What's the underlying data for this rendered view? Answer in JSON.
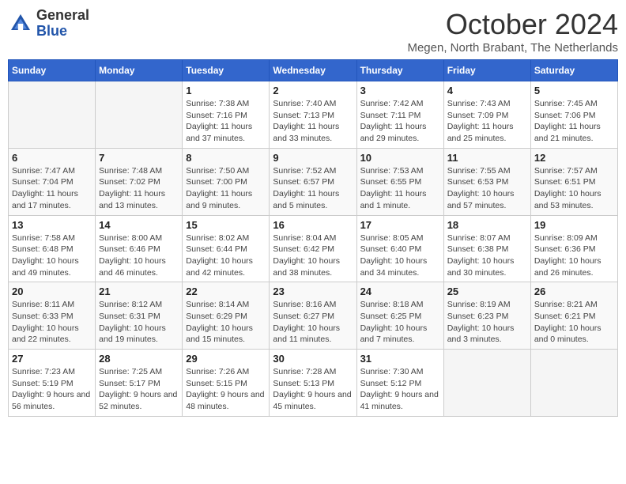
{
  "header": {
    "logo_line1": "General",
    "logo_line2": "Blue",
    "month_title": "October 2024",
    "subtitle": "Megen, North Brabant, The Netherlands"
  },
  "days_of_week": [
    "Sunday",
    "Monday",
    "Tuesday",
    "Wednesday",
    "Thursday",
    "Friday",
    "Saturday"
  ],
  "weeks": [
    [
      {
        "day": "",
        "detail": ""
      },
      {
        "day": "",
        "detail": ""
      },
      {
        "day": "1",
        "detail": "Sunrise: 7:38 AM\nSunset: 7:16 PM\nDaylight: 11 hours and 37 minutes."
      },
      {
        "day": "2",
        "detail": "Sunrise: 7:40 AM\nSunset: 7:13 PM\nDaylight: 11 hours and 33 minutes."
      },
      {
        "day": "3",
        "detail": "Sunrise: 7:42 AM\nSunset: 7:11 PM\nDaylight: 11 hours and 29 minutes."
      },
      {
        "day": "4",
        "detail": "Sunrise: 7:43 AM\nSunset: 7:09 PM\nDaylight: 11 hours and 25 minutes."
      },
      {
        "day": "5",
        "detail": "Sunrise: 7:45 AM\nSunset: 7:06 PM\nDaylight: 11 hours and 21 minutes."
      }
    ],
    [
      {
        "day": "6",
        "detail": "Sunrise: 7:47 AM\nSunset: 7:04 PM\nDaylight: 11 hours and 17 minutes."
      },
      {
        "day": "7",
        "detail": "Sunrise: 7:48 AM\nSunset: 7:02 PM\nDaylight: 11 hours and 13 minutes."
      },
      {
        "day": "8",
        "detail": "Sunrise: 7:50 AM\nSunset: 7:00 PM\nDaylight: 11 hours and 9 minutes."
      },
      {
        "day": "9",
        "detail": "Sunrise: 7:52 AM\nSunset: 6:57 PM\nDaylight: 11 hours and 5 minutes."
      },
      {
        "day": "10",
        "detail": "Sunrise: 7:53 AM\nSunset: 6:55 PM\nDaylight: 11 hours and 1 minute."
      },
      {
        "day": "11",
        "detail": "Sunrise: 7:55 AM\nSunset: 6:53 PM\nDaylight: 10 hours and 57 minutes."
      },
      {
        "day": "12",
        "detail": "Sunrise: 7:57 AM\nSunset: 6:51 PM\nDaylight: 10 hours and 53 minutes."
      }
    ],
    [
      {
        "day": "13",
        "detail": "Sunrise: 7:58 AM\nSunset: 6:48 PM\nDaylight: 10 hours and 49 minutes."
      },
      {
        "day": "14",
        "detail": "Sunrise: 8:00 AM\nSunset: 6:46 PM\nDaylight: 10 hours and 46 minutes."
      },
      {
        "day": "15",
        "detail": "Sunrise: 8:02 AM\nSunset: 6:44 PM\nDaylight: 10 hours and 42 minutes."
      },
      {
        "day": "16",
        "detail": "Sunrise: 8:04 AM\nSunset: 6:42 PM\nDaylight: 10 hours and 38 minutes."
      },
      {
        "day": "17",
        "detail": "Sunrise: 8:05 AM\nSunset: 6:40 PM\nDaylight: 10 hours and 34 minutes."
      },
      {
        "day": "18",
        "detail": "Sunrise: 8:07 AM\nSunset: 6:38 PM\nDaylight: 10 hours and 30 minutes."
      },
      {
        "day": "19",
        "detail": "Sunrise: 8:09 AM\nSunset: 6:36 PM\nDaylight: 10 hours and 26 minutes."
      }
    ],
    [
      {
        "day": "20",
        "detail": "Sunrise: 8:11 AM\nSunset: 6:33 PM\nDaylight: 10 hours and 22 minutes."
      },
      {
        "day": "21",
        "detail": "Sunrise: 8:12 AM\nSunset: 6:31 PM\nDaylight: 10 hours and 19 minutes."
      },
      {
        "day": "22",
        "detail": "Sunrise: 8:14 AM\nSunset: 6:29 PM\nDaylight: 10 hours and 15 minutes."
      },
      {
        "day": "23",
        "detail": "Sunrise: 8:16 AM\nSunset: 6:27 PM\nDaylight: 10 hours and 11 minutes."
      },
      {
        "day": "24",
        "detail": "Sunrise: 8:18 AM\nSunset: 6:25 PM\nDaylight: 10 hours and 7 minutes."
      },
      {
        "day": "25",
        "detail": "Sunrise: 8:19 AM\nSunset: 6:23 PM\nDaylight: 10 hours and 3 minutes."
      },
      {
        "day": "26",
        "detail": "Sunrise: 8:21 AM\nSunset: 6:21 PM\nDaylight: 10 hours and 0 minutes."
      }
    ],
    [
      {
        "day": "27",
        "detail": "Sunrise: 7:23 AM\nSunset: 5:19 PM\nDaylight: 9 hours and 56 minutes."
      },
      {
        "day": "28",
        "detail": "Sunrise: 7:25 AM\nSunset: 5:17 PM\nDaylight: 9 hours and 52 minutes."
      },
      {
        "day": "29",
        "detail": "Sunrise: 7:26 AM\nSunset: 5:15 PM\nDaylight: 9 hours and 48 minutes."
      },
      {
        "day": "30",
        "detail": "Sunrise: 7:28 AM\nSunset: 5:13 PM\nDaylight: 9 hours and 45 minutes."
      },
      {
        "day": "31",
        "detail": "Sunrise: 7:30 AM\nSunset: 5:12 PM\nDaylight: 9 hours and 41 minutes."
      },
      {
        "day": "",
        "detail": ""
      },
      {
        "day": "",
        "detail": ""
      }
    ]
  ]
}
